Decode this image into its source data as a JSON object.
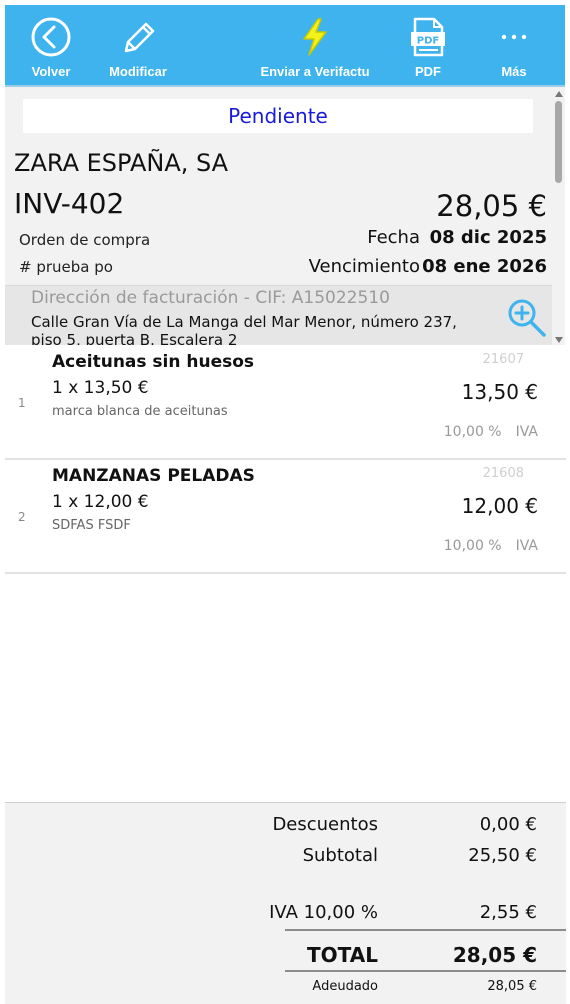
{
  "toolbar": {
    "back_label": "Volver",
    "edit_label": "Modificar",
    "send_label": "Enviar a Verifactu",
    "pdf_label": "PDF",
    "pdf_icon_text": "PDF",
    "more_label": "Más"
  },
  "invoice": {
    "status": "Pendiente",
    "customer": "ZARA ESPAÑA, SA",
    "number": "INV-402",
    "total": "28,05 €",
    "po_label": "Orden de compra",
    "po_value": "# prueba po",
    "date_label": "Fecha",
    "date_value": "08 dic 2025",
    "due_label": "Vencimiento",
    "due_value": "08 ene 2026",
    "billing_title": "Dirección de facturación - CIF: A15022510",
    "billing_address": "Calle Gran Vía de La Manga del Mar Menor, número 237, piso 5, puerta B. Escalera 2"
  },
  "items": [
    {
      "index": "1",
      "name": "Aceitunas sin huesos",
      "qty_price": "1 x 13,50 €",
      "description": "marca blanca de aceitunas",
      "code": "21607",
      "amount": "13,50 €",
      "tax_rate": "10,00 %",
      "tax_name": "IVA"
    },
    {
      "index": "2",
      "name": "MANZANAS PELADAS",
      "qty_price": "1 x 12,00 €",
      "description": "SDFAS FSDF",
      "code": "21608",
      "amount": "12,00 €",
      "tax_rate": "10,00 %",
      "tax_name": "IVA"
    }
  ],
  "totals": {
    "discounts_label": "Descuentos",
    "discounts_value": "0,00 €",
    "subtotal_label": "Subtotal",
    "subtotal_value": "25,50 €",
    "tax_label": "IVA 10,00 %",
    "tax_value": "2,55 €",
    "total_label": "TOTAL",
    "total_value": "28,05 €",
    "due_label": "Adeudado",
    "due_value": "28,05 €"
  },
  "colors": {
    "toolbar": "#3fb3ee",
    "status": "#1a1adb",
    "lightning": "#f2f21a",
    "zoom": "#3fb3ee"
  },
  "icons": {
    "back": "back-circle-icon",
    "edit": "pencil-icon",
    "send": "lightning-icon",
    "pdf": "pdf-file-icon",
    "more": "more-dots-icon",
    "zoom": "zoom-in-icon"
  }
}
